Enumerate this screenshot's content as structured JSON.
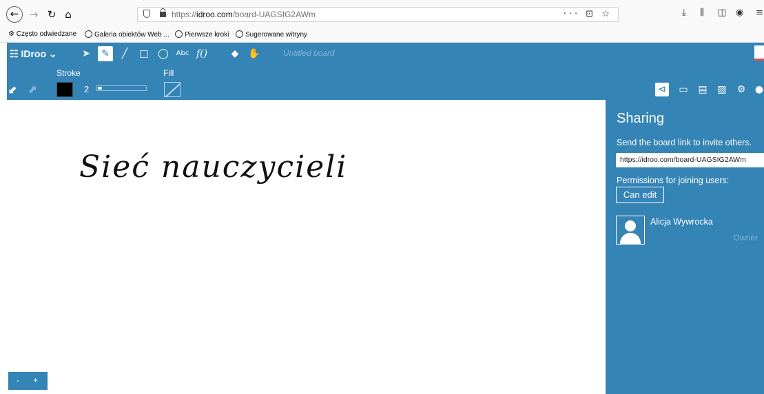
{
  "browser": {
    "url_prefix": "https://",
    "url_domain": "idroo.com",
    "url_path": "/board-UAGSIG2AWm",
    "url_actions": "··· ⊡ ☆",
    "bookmarks": [
      {
        "label": "Często odwiedzane",
        "icon": "gear-icon"
      },
      {
        "label": "Galeria obiektów Web ...",
        "icon": "globe-icon"
      },
      {
        "label": "Pierwsze kroki",
        "icon": "globe-icon"
      },
      {
        "label": "Sugerowane witryny",
        "icon": "globe-icon"
      }
    ]
  },
  "app": {
    "brand": "IDroo ⌄",
    "board_title": "Untitled board",
    "stroke_label": "Stroke",
    "stroke_width": "2",
    "stroke_color": "#000000",
    "fill_label": "Fill",
    "accent_color": "#3584b6",
    "tools": [
      "select",
      "pen",
      "line",
      "rectangle",
      "ellipse",
      "text",
      "formula",
      "eraser",
      "pan"
    ],
    "text_tool": "Abc",
    "formula_tool": "f()"
  },
  "canvas": {
    "handwritten_text": "Sieć nauczycieli",
    "zoom_out": "-",
    "zoom_in": "+"
  },
  "sharing": {
    "title": "Sharing",
    "description": "Send the board link to invite others.",
    "link": "https://idroo.com/board-UAGSIG2AWm",
    "permissions_label": "Permissions for joining users:",
    "permission_value": "Can edit",
    "user_name": "Alicja Wywrocka",
    "user_role": "Owner"
  }
}
